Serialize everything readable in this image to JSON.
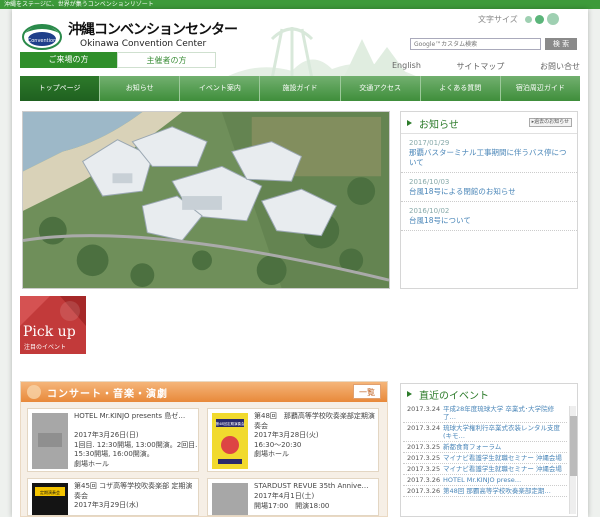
{
  "topbar": {
    "tagline": "沖縄をステージに、世界が集うコンベンションリゾート"
  },
  "logo": {
    "jp": "沖縄コンベンションセンター",
    "en": "Okinawa Convention Center",
    "emblem_text": "Convention"
  },
  "visitor_tabs": [
    {
      "label": "ご来場の方",
      "active": true
    },
    {
      "label": "主催者の方",
      "active": false
    }
  ],
  "font_size": {
    "label": "文字サイズ"
  },
  "search": {
    "placeholder": "Google™カスタム検索",
    "button": "検 索"
  },
  "util_links": [
    "English",
    "サイトマップ",
    "お問い合せ"
  ],
  "nav": [
    "トップページ",
    "お知らせ",
    "イベント案内",
    "施設ガイド",
    "交通アクセス",
    "よくある質問",
    "宿泊周辺ガイド"
  ],
  "news": {
    "title": "お知らせ",
    "more": "▸過去のお知らせ",
    "items": [
      {
        "date": "2017/01/29",
        "text": "那覇バスターミナル工事期間に伴うバス停について"
      },
      {
        "date": "2016/10/03",
        "text": "台風18号による閉館のお知らせ"
      },
      {
        "date": "2016/10/02",
        "text": "台風18号について"
      }
    ]
  },
  "pickup": {
    "title": "Pick up",
    "subtitle": "注目のイベント"
  },
  "concert": {
    "title": "コンサート・音楽・演劇",
    "list_button": "一覧",
    "events": [
      {
        "title": "HOTEL Mr.KINJO presents 島ゼ…",
        "date": "2017年3月26日(日)",
        "detail": "1回目. 12:30開場, 13:00開演。2回目. 15:30開場, 16:00開演。",
        "venue": "劇場ホール"
      },
      {
        "title": "第48回　那覇高等学校吹奏楽部定期演奏会",
        "date": "2017年3月28日(火)",
        "detail": "16:30～20:30",
        "venue": "劇場ホール"
      },
      {
        "title": "第45回 コザ高等学校吹奏楽部 定期演奏会",
        "date": "2017年3月29日(水)",
        "detail": "",
        "venue": ""
      },
      {
        "title": "STARDUST REVUE 35th Annive…",
        "date": "2017年4月1日(土)",
        "detail": "開場17:00　開演18:00",
        "venue": ""
      }
    ],
    "poster_text": "第48回定期演奏会",
    "poster_text2": "定期演奏会"
  },
  "recent": {
    "title": "直近のイベント",
    "items": [
      {
        "date": "2017.3.24",
        "text": "平成28年度琉球大学 卒業式･大学院修了…"
      },
      {
        "date": "2017.3.24",
        "text": "琉球大学権利行卒業式衣装レンタル支度(キモ…"
      },
      {
        "date": "2017.3.25",
        "text": "新都食育フォーラム"
      },
      {
        "date": "2017.3.25",
        "text": "マイナビ看護学生就職セミナー 沖縄会場"
      },
      {
        "date": "2017.3.25",
        "text": "マイナビ看護学生就職セミナー 沖縄会場"
      },
      {
        "date": "2017.3.26",
        "text": "HOTEL Mr.KINJO prese…"
      },
      {
        "date": "2017.3.26",
        "text": "第48回 那覇高等学校吹奏楽部定期…"
      }
    ]
  },
  "colors": {
    "brand_green": "#3d9a3a",
    "concert_orange": "#e8893a",
    "link_blue": "#4a86b8"
  }
}
